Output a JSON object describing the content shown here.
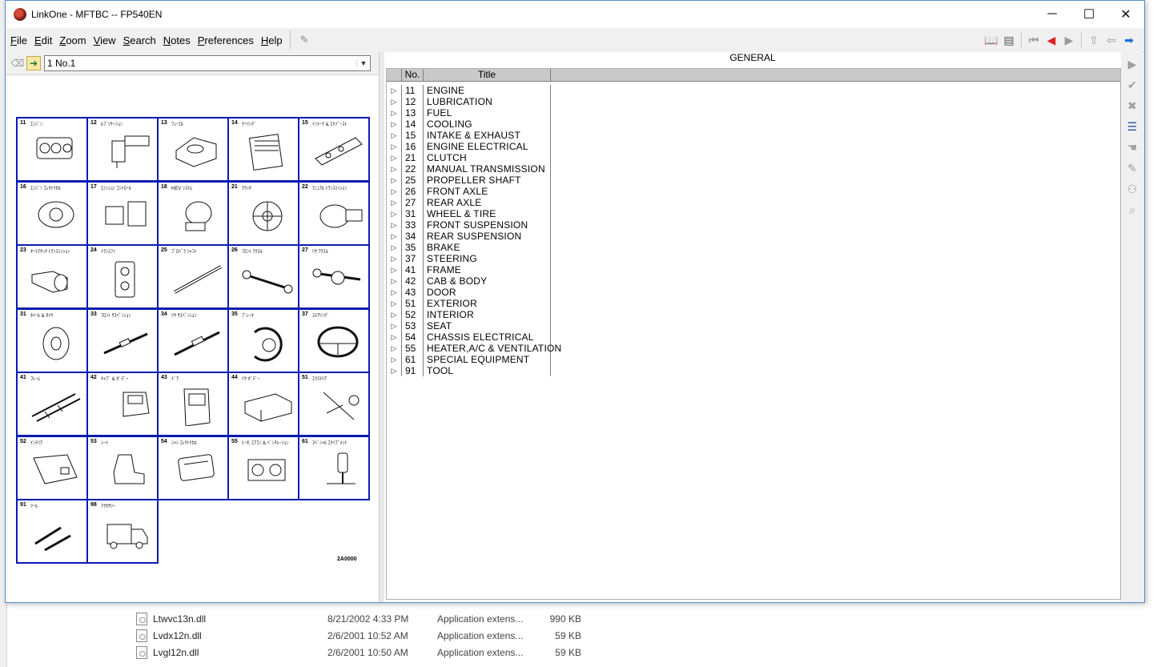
{
  "window": {
    "title": "LinkOne - MFTBC -- FP540EN",
    "minimize_glyph": "─",
    "maximize_glyph": "☐",
    "close_glyph": "✕"
  },
  "menu": [
    {
      "accel": "F",
      "rest": "ile"
    },
    {
      "accel": "E",
      "rest": "dit"
    },
    {
      "accel": "Z",
      "rest": "oom"
    },
    {
      "accel": "V",
      "rest": "iew"
    },
    {
      "accel": "S",
      "rest": "earch"
    },
    {
      "accel": "N",
      "rest": "otes"
    },
    {
      "accel": "P",
      "rest": "references"
    },
    {
      "accel": "H",
      "rest": "elp"
    }
  ],
  "toolbar": {
    "icons": [
      "book-icon",
      "notes-icon",
      "first-page-icon",
      "prev-page-icon",
      "next-page-icon",
      "home-icon",
      "back-icon",
      "forward-icon"
    ]
  },
  "left_pane": {
    "selector_value": "1 No.1",
    "drawing_code": "2A0000",
    "cells": [
      {
        "no": "11",
        "kana": "ｴﾝｼﾞﾝ"
      },
      {
        "no": "12",
        "kana": "ﾙﾌﾞﾘｹｰｼｮﾝ"
      },
      {
        "no": "13",
        "kana": "ﾌｭｰｴﾙ"
      },
      {
        "no": "14",
        "kana": "ｸｰﾘﾝｸﾞ"
      },
      {
        "no": "15",
        "kana": "ｲﾝﾃｰｸ & ｴｷｿﾞｰｽﾄ"
      },
      {
        "no": "16",
        "kana": "ｴﾝｼﾞﾝ ｴﾚｸﾄﾘｶﾙ"
      },
      {
        "no": "17",
        "kana": "ｴﾐｯｼｮﾝ ｺﾝﾄﾛｰﾙ"
      },
      {
        "no": "18",
        "kana": "HEV ｼｽﾃﾑ"
      },
      {
        "no": "21",
        "kana": "ｸﾗｯﾁ"
      },
      {
        "no": "22",
        "kana": "ﾏﾆｭｱﾙ ﾄﾗﾝｽﾐｯｼｮﾝ"
      },
      {
        "no": "23",
        "kana": "ｵｰﾄﾏﾁｯｸ ﾄﾗﾝｽﾐｯｼｮﾝ"
      },
      {
        "no": "24",
        "kana": "ﾄﾗﾝｽﾌｧ"
      },
      {
        "no": "25",
        "kana": "ﾌﾟﾛﾍﾟﾗ ｼｬﾌﾄ"
      },
      {
        "no": "26",
        "kana": "ﾌﾛﾝﾄ ｱｸｽﾙ"
      },
      {
        "no": "27",
        "kana": "ﾘﾔ ｱｸｽﾙ"
      },
      {
        "no": "31",
        "kana": "ﾎｲｰﾙ & ﾀｲﾔ"
      },
      {
        "no": "33",
        "kana": "ﾌﾛﾝﾄ ｻｽﾍﾟﾝｼｮﾝ"
      },
      {
        "no": "34",
        "kana": "ﾘﾔ ｻｽﾍﾟﾝｼｮﾝ"
      },
      {
        "no": "35",
        "kana": "ﾌﾞﾚｰｷ"
      },
      {
        "no": "37",
        "kana": "ｽﾃｱﾘﾝｸﾞ"
      },
      {
        "no": "41",
        "kana": "ﾌﾚｰﾑ"
      },
      {
        "no": "42",
        "kana": "ｷｬﾌﾞ & ﾎﾞﾃﾞｰ"
      },
      {
        "no": "43",
        "kana": "ﾄﾞｱ"
      },
      {
        "no": "44",
        "kana": "ﾘﾔ ﾎﾞﾃﾞｰ"
      },
      {
        "no": "51",
        "kana": "ｴｸｽﾃﾘｱ"
      },
      {
        "no": "52",
        "kana": "ｲﾝﾃﾘｱ"
      },
      {
        "no": "53",
        "kana": "ｼｰﾄ"
      },
      {
        "no": "54",
        "kana": "ｼｬｼ ｴﾚｸﾄﾘｶﾙ"
      },
      {
        "no": "55",
        "kana": "ﾋｰﾀ, ｴｱｺﾝ & ﾍﾞﾝﾁﾚｰｼｮﾝ"
      },
      {
        "no": "61",
        "kana": "ｽﾍﾟｼｬﾙ ｴｸｲﾌﾟﾒﾝﾄ"
      },
      {
        "no": "91",
        "kana": "ﾂｰﾙ"
      },
      {
        "no": "98",
        "kana": "ｱｸｾｻﾘｰ"
      }
    ]
  },
  "right_pane": {
    "heading": "GENERAL",
    "columns": {
      "no": "No.",
      "title": "Title"
    },
    "rows": [
      {
        "no": "11",
        "title": "ENGINE"
      },
      {
        "no": "12",
        "title": "LUBRICATION"
      },
      {
        "no": "13",
        "title": "FUEL"
      },
      {
        "no": "14",
        "title": "COOLING"
      },
      {
        "no": "15",
        "title": "INTAKE & EXHAUST"
      },
      {
        "no": "16",
        "title": "ENGINE ELECTRICAL"
      },
      {
        "no": "21",
        "title": "CLUTCH"
      },
      {
        "no": "22",
        "title": "MANUAL TRANSMISSION"
      },
      {
        "no": "25",
        "title": "PROPELLER SHAFT"
      },
      {
        "no": "26",
        "title": "FRONT AXLE"
      },
      {
        "no": "27",
        "title": "REAR AXLE"
      },
      {
        "no": "31",
        "title": "WHEEL & TIRE"
      },
      {
        "no": "33",
        "title": "FRONT SUSPENSION"
      },
      {
        "no": "34",
        "title": "REAR SUSPENSION"
      },
      {
        "no": "35",
        "title": "BRAKE"
      },
      {
        "no": "37",
        "title": "STEERING"
      },
      {
        "no": "41",
        "title": "FRAME"
      },
      {
        "no": "42",
        "title": "CAB & BODY"
      },
      {
        "no": "43",
        "title": "DOOR"
      },
      {
        "no": "51",
        "title": "EXTERIOR"
      },
      {
        "no": "52",
        "title": "INTERIOR"
      },
      {
        "no": "53",
        "title": "SEAT"
      },
      {
        "no": "54",
        "title": "CHASSIS ELECTRICAL"
      },
      {
        "no": "55",
        "title": "HEATER,A/C & VENTILATION"
      },
      {
        "no": "61",
        "title": "SPECIAL EQUIPMENT"
      },
      {
        "no": "91",
        "title": "TOOL"
      }
    ]
  },
  "background_files": [
    {
      "name": "Ltwvc13n.dll",
      "date": "8/21/2002 4:33 PM",
      "type": "Application extens...",
      "size": "990 KB"
    },
    {
      "name": "Lvdx12n.dll",
      "date": "2/6/2001 10:52 AM",
      "type": "Application extens...",
      "size": "59 KB"
    },
    {
      "name": "Lvgl12n.dll",
      "date": "2/6/2001 10:50 AM",
      "type": "Application extens...",
      "size": "59 KB"
    }
  ]
}
